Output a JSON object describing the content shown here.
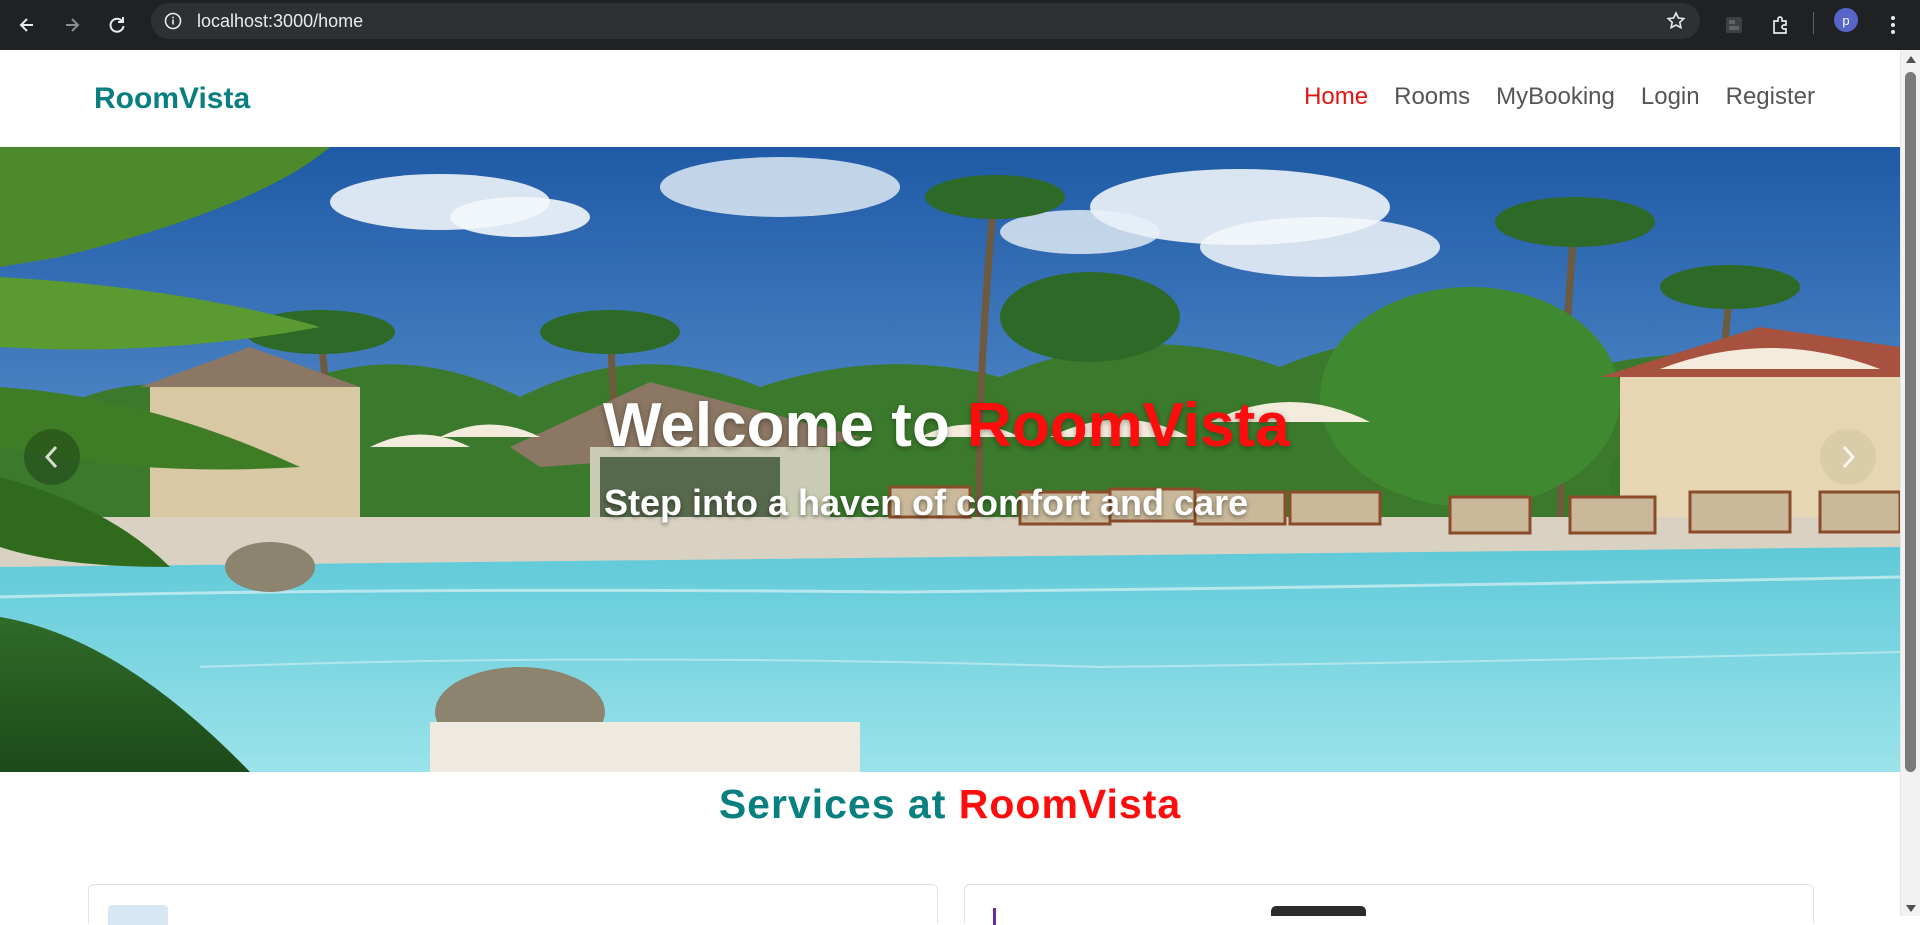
{
  "browser": {
    "url": "localhost:3000/home",
    "profile_initial": "p"
  },
  "header": {
    "brand": "RoomVista",
    "nav": [
      {
        "label": "Home",
        "active": true
      },
      {
        "label": "Rooms",
        "active": false
      },
      {
        "label": "MyBooking",
        "active": false
      },
      {
        "label": "Login",
        "active": false
      },
      {
        "label": "Register",
        "active": false
      }
    ]
  },
  "hero": {
    "title_prefix": "Welcome to ",
    "title_accent": "RoomVista",
    "subtitle": "Step into a haven of comfort and care",
    "prev_icon": "chevron-left-icon",
    "next_icon": "chevron-right-icon"
  },
  "services": {
    "title_prefix": "Services at ",
    "title_accent": "RoomVista"
  },
  "colors": {
    "brand": "#0a7f80",
    "accent": "#ff0d0d",
    "nav_active": "#e51313",
    "nav_text": "#555555"
  }
}
